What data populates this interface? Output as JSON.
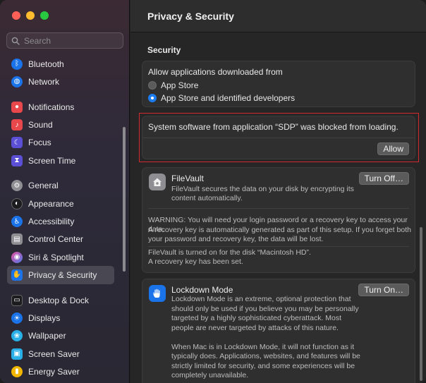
{
  "sidebar": {
    "search_placeholder": "Search",
    "items": [
      {
        "label": "Bluetooth",
        "icon": "bluetooth-icon",
        "color": "#1a73e8"
      },
      {
        "label": "Network",
        "icon": "network-icon",
        "color": "#1a73e8"
      },
      {
        "label": "Notifications",
        "icon": "notifications-icon",
        "color": "#e8484b"
      },
      {
        "label": "Sound",
        "icon": "sound-icon",
        "color": "#e8484b"
      },
      {
        "label": "Focus",
        "icon": "focus-icon",
        "color": "#5b4fd6"
      },
      {
        "label": "Screen Time",
        "icon": "screen-time-icon",
        "color": "#5b4fd6"
      },
      {
        "label": "General",
        "icon": "general-icon",
        "color": "#8e8e93"
      },
      {
        "label": "Appearance",
        "icon": "appearance-icon",
        "color": "#1c1c1e"
      },
      {
        "label": "Accessibility",
        "icon": "accessibility-icon",
        "color": "#1a73e8"
      },
      {
        "label": "Control Center",
        "icon": "control-center-icon",
        "color": "#8e8e93"
      },
      {
        "label": "Siri & Spotlight",
        "icon": "siri-icon",
        "color": "#9b59d0"
      },
      {
        "label": "Privacy & Security",
        "icon": "privacy-hand-icon",
        "color": "#1a73e8"
      },
      {
        "label": "Desktop & Dock",
        "icon": "desktop-dock-icon",
        "color": "#1c1c1e"
      },
      {
        "label": "Displays",
        "icon": "displays-icon",
        "color": "#1a73e8"
      },
      {
        "label": "Wallpaper",
        "icon": "wallpaper-icon",
        "color": "#2ab0e8"
      },
      {
        "label": "Screen Saver",
        "icon": "screen-saver-icon",
        "color": "#2ab0e8"
      },
      {
        "label": "Energy Saver",
        "icon": "energy-saver-icon",
        "color": "#f2b600"
      }
    ]
  },
  "main": {
    "title": "Privacy & Security",
    "section_title": "Security",
    "allow_apps": {
      "label": "Allow applications downloaded from",
      "options": [
        "App Store",
        "App Store and identified developers"
      ],
      "selected": "App Store and identified developers"
    },
    "blocked": {
      "message": "System software from application “SDP” was blocked from loading.",
      "button": "Allow"
    },
    "filevault": {
      "title": "FileVault",
      "desc_line1": "FileVault secures the data on your disk by encrypting its",
      "desc_line2": "content automatically.",
      "button": "Turn Off…",
      "warning_line1": "WARNING: You will need your login password or a recovery key to access your data.",
      "warning_line2": "A recovery key is automatically generated as part of this setup. If you forget both",
      "warning_line3": "your password and recovery key, the data will be lost.",
      "status_line1": "FileVault is turned on for the disk “Macintosh HD”.",
      "status_line2": "A recovery key has been set."
    },
    "lockdown": {
      "title": "Lockdown Mode",
      "button": "Turn On…",
      "desc_line1": "Lockdown Mode is an extreme, optional protection that",
      "desc_line2": "should only be used if you believe you may be personally",
      "desc_line3": "targeted by a highly sophisticated cyberattack. Most",
      "desc_line4": "people are never targeted by attacks of this nature.",
      "desc_line5": "When Mac is in Lockdown Mode, it will not function as it",
      "desc_line6": "typically does. Applications, websites, and features will be",
      "desc_line7": "strictly limited for security, and some experiences will be",
      "desc_line8": "completely unavailable."
    }
  },
  "colors": {
    "accent": "#1d7cf2",
    "highlight_border": "#d42a2f"
  }
}
